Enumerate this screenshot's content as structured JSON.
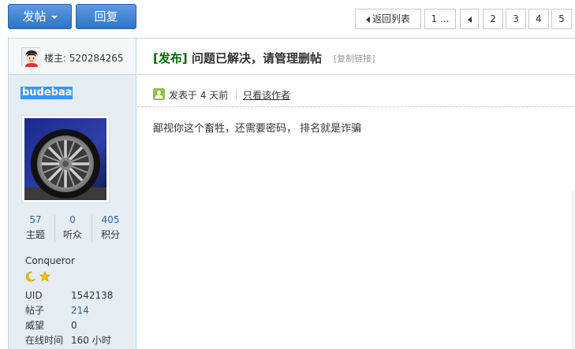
{
  "toolbar": {
    "post_label": "发帖",
    "reply_label": "回复"
  },
  "pagination": {
    "back_label": "返回列表",
    "first_label": "1 ...",
    "pages": [
      "2",
      "3",
      "4",
      "5"
    ]
  },
  "sidebar": {
    "floor_label": "楼主: 520284265",
    "username": "budebaa",
    "stats": [
      {
        "value": "57",
        "label": "主题"
      },
      {
        "value": "0",
        "label": "听众"
      },
      {
        "value": "405",
        "label": "积分"
      }
    ],
    "rank": "Conqueror",
    "medal_icons": [
      "moon-icon",
      "star-icon"
    ],
    "info": [
      {
        "key": "UID",
        "value": "1542138"
      },
      {
        "key": "帖子",
        "value": "214"
      },
      {
        "key": "威望",
        "value": "0"
      },
      {
        "key": "在线时间",
        "value": "160 小时"
      }
    ]
  },
  "post": {
    "tag": "[发布]",
    "title": "问题已解决，请管理删帖",
    "copy_link": "[复制链接]",
    "posted": "发表于 4 天前",
    "only_author": "只看该作者",
    "body": "鄙视你这个畜牲，还需要密码，  排名就是诈骗"
  },
  "colors": {
    "accent_blue": "#2f74c6",
    "sidebar_bg": "#e5edf2",
    "tag_green": "#006600",
    "link_blue": "#336699"
  }
}
